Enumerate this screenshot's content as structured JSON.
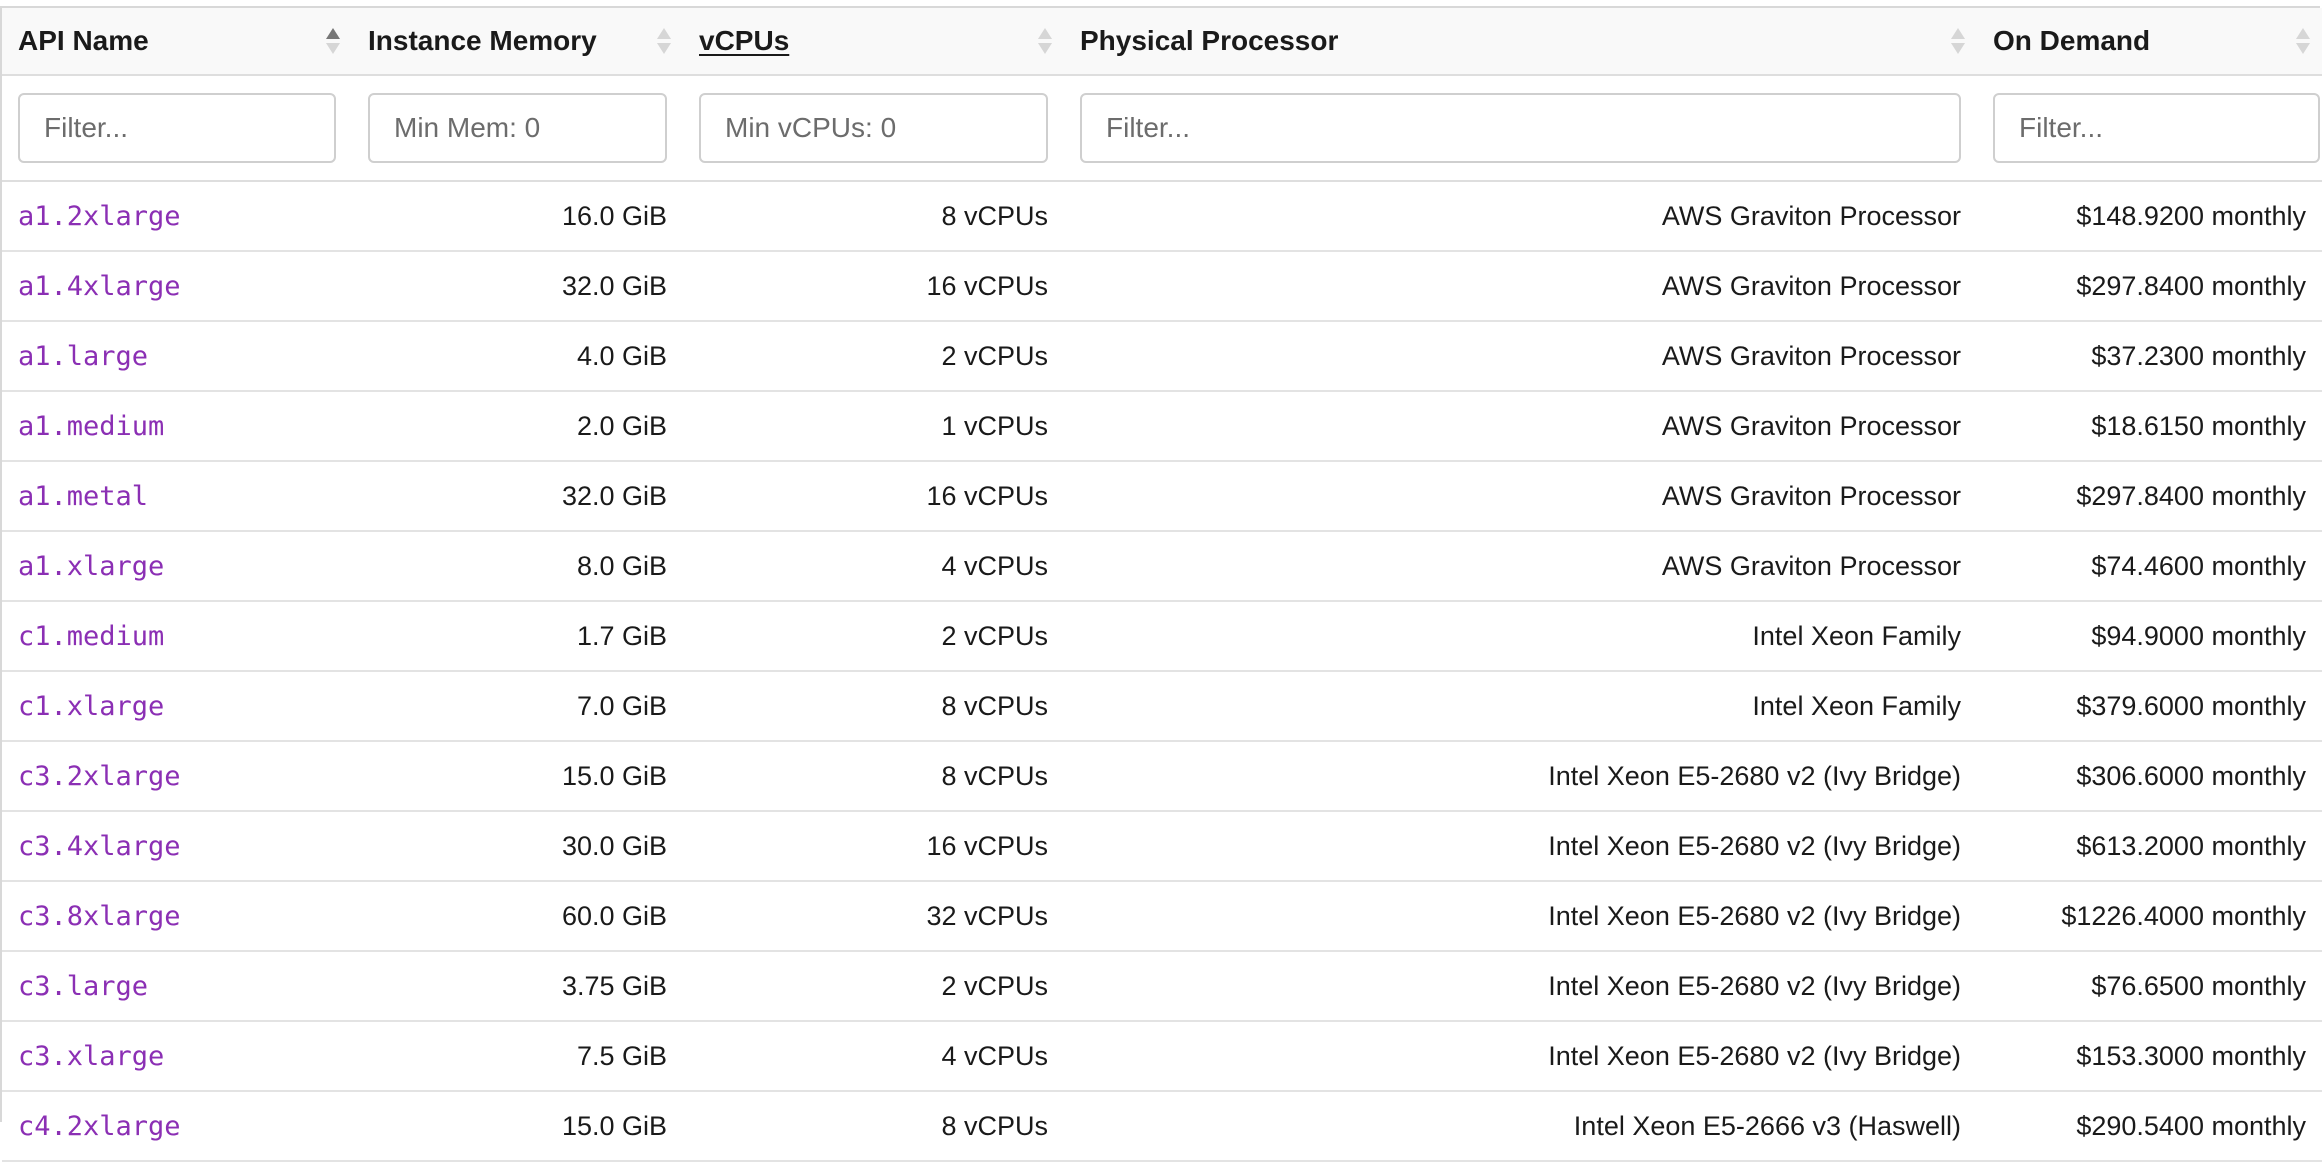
{
  "headers": {
    "api_name": "API Name",
    "memory": "Instance Memory",
    "vcpus": "vCPUs",
    "processor": "Physical Processor",
    "on_demand": "On Demand"
  },
  "filters": {
    "api_name_placeholder": "Filter...",
    "memory_placeholder": "Min Mem: 0",
    "vcpus_placeholder": "Min vCPUs: 0",
    "processor_placeholder": "Filter...",
    "on_demand_placeholder": "Filter..."
  },
  "sort": {
    "column": "api_name",
    "direction": "ascending"
  },
  "colors": {
    "link": "#8b2fb4",
    "border": "#dedede"
  },
  "rows": [
    {
      "api_name": "a1.2xlarge",
      "memory": "16.0 GiB",
      "vcpus": "8 vCPUs",
      "processor": "AWS Graviton Processor",
      "on_demand": "$148.9200 monthly"
    },
    {
      "api_name": "a1.4xlarge",
      "memory": "32.0 GiB",
      "vcpus": "16 vCPUs",
      "processor": "AWS Graviton Processor",
      "on_demand": "$297.8400 monthly"
    },
    {
      "api_name": "a1.large",
      "memory": "4.0 GiB",
      "vcpus": "2 vCPUs",
      "processor": "AWS Graviton Processor",
      "on_demand": "$37.2300 monthly"
    },
    {
      "api_name": "a1.medium",
      "memory": "2.0 GiB",
      "vcpus": "1 vCPUs",
      "processor": "AWS Graviton Processor",
      "on_demand": "$18.6150 monthly"
    },
    {
      "api_name": "a1.metal",
      "memory": "32.0 GiB",
      "vcpus": "16 vCPUs",
      "processor": "AWS Graviton Processor",
      "on_demand": "$297.8400 monthly"
    },
    {
      "api_name": "a1.xlarge",
      "memory": "8.0 GiB",
      "vcpus": "4 vCPUs",
      "processor": "AWS Graviton Processor",
      "on_demand": "$74.4600 monthly"
    },
    {
      "api_name": "c1.medium",
      "memory": "1.7 GiB",
      "vcpus": "2 vCPUs",
      "processor": "Intel Xeon Family",
      "on_demand": "$94.9000 monthly"
    },
    {
      "api_name": "c1.xlarge",
      "memory": "7.0 GiB",
      "vcpus": "8 vCPUs",
      "processor": "Intel Xeon Family",
      "on_demand": "$379.6000 monthly"
    },
    {
      "api_name": "c3.2xlarge",
      "memory": "15.0 GiB",
      "vcpus": "8 vCPUs",
      "processor": "Intel Xeon E5-2680 v2 (Ivy Bridge)",
      "on_demand": "$306.6000 monthly"
    },
    {
      "api_name": "c3.4xlarge",
      "memory": "30.0 GiB",
      "vcpus": "16 vCPUs",
      "processor": "Intel Xeon E5-2680 v2 (Ivy Bridge)",
      "on_demand": "$613.2000 monthly"
    },
    {
      "api_name": "c3.8xlarge",
      "memory": "60.0 GiB",
      "vcpus": "32 vCPUs",
      "processor": "Intel Xeon E5-2680 v2 (Ivy Bridge)",
      "on_demand": "$1226.4000 monthly"
    },
    {
      "api_name": "c3.large",
      "memory": "3.75 GiB",
      "vcpus": "2 vCPUs",
      "processor": "Intel Xeon E5-2680 v2 (Ivy Bridge)",
      "on_demand": "$76.6500 monthly"
    },
    {
      "api_name": "c3.xlarge",
      "memory": "7.5 GiB",
      "vcpus": "4 vCPUs",
      "processor": "Intel Xeon E5-2680 v2 (Ivy Bridge)",
      "on_demand": "$153.3000 monthly"
    },
    {
      "api_name": "c4.2xlarge",
      "memory": "15.0 GiB",
      "vcpus": "8 vCPUs",
      "processor": "Intel Xeon E5-2666 v3 (Haswell)",
      "on_demand": "$290.5400 monthly"
    }
  ]
}
